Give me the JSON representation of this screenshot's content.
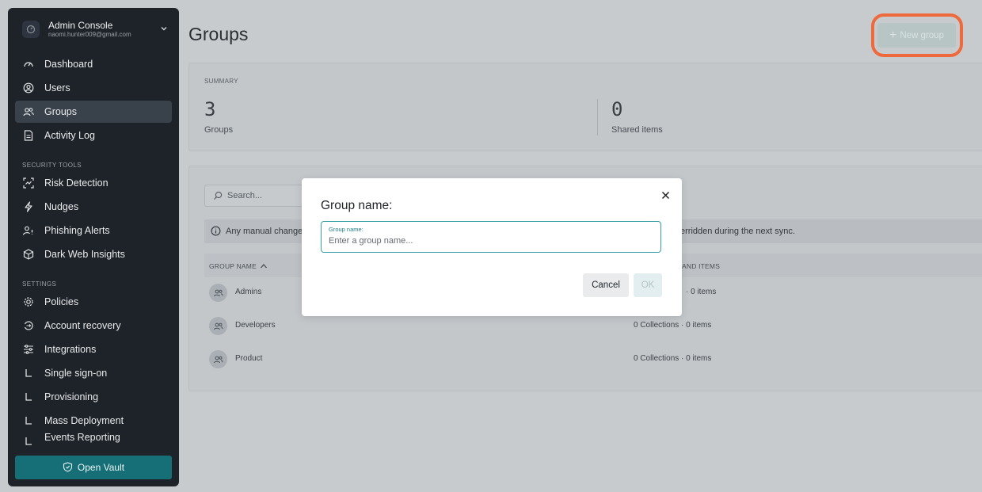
{
  "account": {
    "title": "Admin Console",
    "email": "naomi.hunter009@gmail.com"
  },
  "nav": {
    "items": [
      {
        "label": "Dashboard",
        "icon": "gauge-icon"
      },
      {
        "label": "Users",
        "icon": "user-circle-icon"
      },
      {
        "label": "Groups",
        "icon": "users-icon",
        "active": true
      },
      {
        "label": "Activity Log",
        "icon": "document-icon"
      }
    ],
    "security_label": "SECURITY TOOLS",
    "security_items": [
      {
        "label": "Risk Detection",
        "icon": "scan-icon"
      },
      {
        "label": "Nudges",
        "icon": "bolt-icon"
      },
      {
        "label": "Phishing Alerts",
        "icon": "user-alert-icon"
      },
      {
        "label": "Dark Web Insights",
        "icon": "cube-icon"
      }
    ],
    "settings_label": "SETTINGS",
    "settings_items": [
      {
        "label": "Policies",
        "icon": "gear-icon"
      },
      {
        "label": "Account recovery",
        "icon": "recovery-icon"
      },
      {
        "label": "Integrations",
        "icon": "sliders-icon"
      },
      {
        "label": "Single sign-on",
        "icon": "corner-icon"
      },
      {
        "label": "Provisioning",
        "icon": "corner-icon"
      },
      {
        "label": "Mass Deployment",
        "icon": "corner-icon"
      },
      {
        "label": "Events Reporting",
        "icon": "corner-icon"
      }
    ],
    "open_vault": "Open Vault"
  },
  "header": {
    "title": "Groups",
    "new_group": "New group"
  },
  "summary": {
    "label": "SUMMARY",
    "groups_count": "3",
    "groups_label": "Groups",
    "shared_count": "0",
    "shared_label": "Shared items"
  },
  "list": {
    "search_placeholder": "Search...",
    "notice_left": "Any manual change",
    "notice_right": "erridden during the next sync.",
    "col_name": "GROUP NAME",
    "col_items": "AND ITEMS",
    "rows": [
      {
        "name": "Admins",
        "count": "· 0 items"
      },
      {
        "name": "Developers",
        "count": "0 Collections · 0 items"
      },
      {
        "name": "Product",
        "count": "0 Collections · 0 items"
      }
    ]
  },
  "dialog": {
    "title": "Group name:",
    "field_label": "Group name:",
    "placeholder": "Enter a group name...",
    "cancel": "Cancel",
    "ok": "OK"
  },
  "colors": {
    "accent": "#166f77",
    "highlight": "#ee6a3d",
    "sidebar_bg": "#1e2329"
  }
}
